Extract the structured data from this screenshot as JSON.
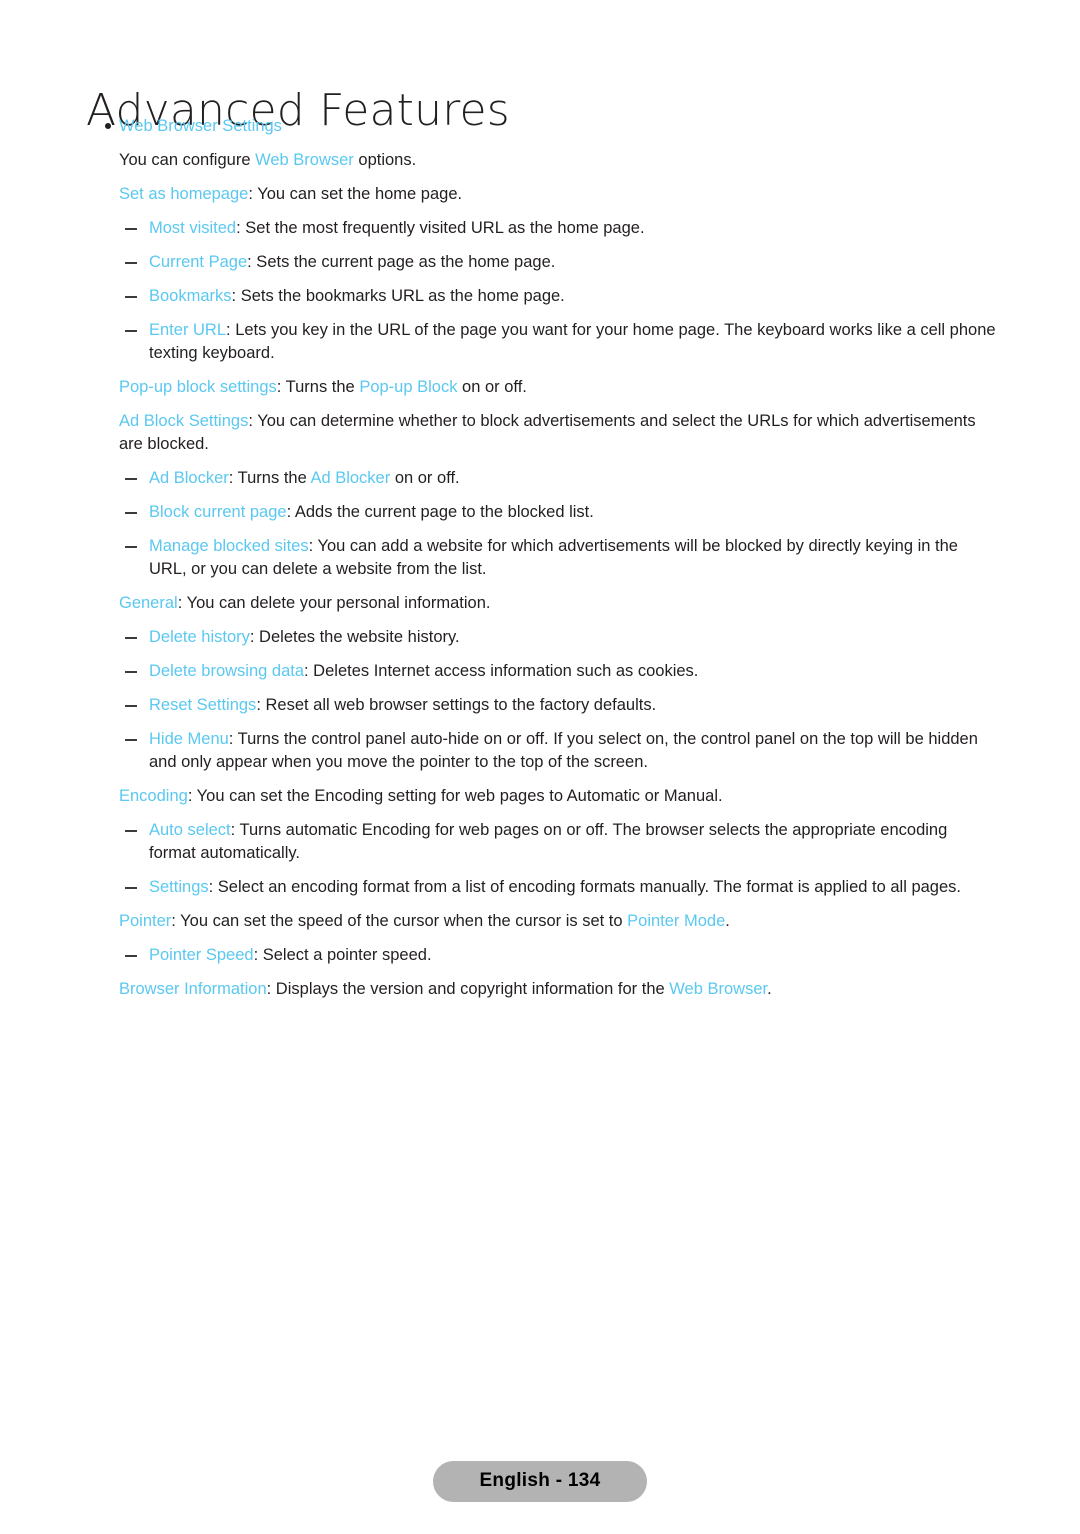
{
  "document": {
    "title": "Advanced Features",
    "accent_color": "#5ac8f0",
    "text_color": "#231f20"
  },
  "section": {
    "heading": "Web Browser Settings",
    "bullet_icon": "bullet-dot-icon",
    "dash_icon": "dash-marker-icon"
  },
  "blocks": [
    {
      "id": "intro",
      "type": "paragraph",
      "runs": [
        {
          "text": "You can configure ",
          "accent": false
        },
        {
          "text": "Web Browser",
          "accent": true
        },
        {
          "text": " options.",
          "accent": false
        }
      ]
    },
    {
      "id": "set-as-homepage",
      "type": "paragraph",
      "runs": [
        {
          "text": "Set as homepage",
          "accent": true
        },
        {
          "text": ": You can set the home page.",
          "accent": false
        }
      ]
    },
    {
      "id": "most-visited",
      "type": "dash",
      "runs": [
        {
          "text": "Most visited",
          "accent": true
        },
        {
          "text": ": Set the most frequently visited URL as the home page.",
          "accent": false
        }
      ]
    },
    {
      "id": "current-page",
      "type": "dash",
      "runs": [
        {
          "text": "Current Page",
          "accent": true
        },
        {
          "text": ": Sets the current page as the home page.",
          "accent": false
        }
      ]
    },
    {
      "id": "bookmarks",
      "type": "dash",
      "runs": [
        {
          "text": "Bookmarks",
          "accent": true
        },
        {
          "text": ": Sets the bookmarks URL as the home page.",
          "accent": false
        }
      ]
    },
    {
      "id": "enter-url",
      "type": "dash",
      "runs": [
        {
          "text": "Enter URL",
          "accent": true
        },
        {
          "text": ": Lets you key in the URL of the page you want for your home page. The keyboard works like a cell phone texting keyboard.",
          "accent": false
        }
      ]
    },
    {
      "id": "popup-block-settings",
      "type": "paragraph",
      "runs": [
        {
          "text": "Pop-up block settings",
          "accent": true
        },
        {
          "text": ": Turns the ",
          "accent": false
        },
        {
          "text": "Pop-up Block",
          "accent": true
        },
        {
          "text": " on or off.",
          "accent": false
        }
      ]
    },
    {
      "id": "ad-block-settings",
      "type": "paragraph",
      "runs": [
        {
          "text": "Ad Block Settings",
          "accent": true
        },
        {
          "text": ": You can determine whether to block advertisements and select the URLs for which advertisements are blocked.",
          "accent": false
        }
      ]
    },
    {
      "id": "ad-blocker",
      "type": "dash",
      "runs": [
        {
          "text": "Ad Blocker",
          "accent": true
        },
        {
          "text": ": Turns the ",
          "accent": false
        },
        {
          "text": "Ad Blocker",
          "accent": true
        },
        {
          "text": " on or off.",
          "accent": false
        }
      ]
    },
    {
      "id": "block-current-page",
      "type": "dash",
      "runs": [
        {
          "text": "Block current page",
          "accent": true
        },
        {
          "text": ": Adds the current page to the blocked list.",
          "accent": false
        }
      ]
    },
    {
      "id": "manage-blocked-sites",
      "type": "dash",
      "runs": [
        {
          "text": "Manage blocked sites",
          "accent": true
        },
        {
          "text": ": You can add a website for which advertisements will be blocked by directly keying in the URL, or you can delete a website from the list.",
          "accent": false
        }
      ]
    },
    {
      "id": "general",
      "type": "paragraph",
      "runs": [
        {
          "text": "General",
          "accent": true
        },
        {
          "text": ": You can delete your personal information.",
          "accent": false
        }
      ]
    },
    {
      "id": "delete-history",
      "type": "dash",
      "runs": [
        {
          "text": "Delete history",
          "accent": true
        },
        {
          "text": ": Deletes the website history.",
          "accent": false
        }
      ]
    },
    {
      "id": "delete-browsing-data",
      "type": "dash",
      "runs": [
        {
          "text": "Delete browsing data",
          "accent": true
        },
        {
          "text": ": Deletes Internet access information such as cookies.",
          "accent": false
        }
      ]
    },
    {
      "id": "reset-settings",
      "type": "dash",
      "runs": [
        {
          "text": "Reset Settings",
          "accent": true
        },
        {
          "text": ": Reset all web browser settings to the factory defaults.",
          "accent": false
        }
      ]
    },
    {
      "id": "hide-menu",
      "type": "dash",
      "runs": [
        {
          "text": "Hide Menu",
          "accent": true
        },
        {
          "text": ": Turns the control panel auto-hide on or off. If you select on, the control panel on the top will be hidden and only appear when you move the pointer to the top of the screen.",
          "accent": false
        }
      ]
    },
    {
      "id": "encoding",
      "type": "paragraph",
      "runs": [
        {
          "text": "Encoding",
          "accent": true
        },
        {
          "text": ": You can set the Encoding setting for web pages to Automatic or Manual.",
          "accent": false
        }
      ]
    },
    {
      "id": "auto-select",
      "type": "dash",
      "runs": [
        {
          "text": "Auto select",
          "accent": true
        },
        {
          "text": ": Turns automatic Encoding for web pages on or off. The browser selects the appropriate encoding format automatically.",
          "accent": false
        }
      ]
    },
    {
      "id": "settings",
      "type": "dash",
      "runs": [
        {
          "text": "Settings",
          "accent": true
        },
        {
          "text": ": Select an encoding format from a list of encoding formats manually. The format is applied to all pages.",
          "accent": false
        }
      ]
    },
    {
      "id": "pointer",
      "type": "paragraph",
      "runs": [
        {
          "text": "Pointer",
          "accent": true
        },
        {
          "text": ": You can set the speed of the cursor when the cursor is set to ",
          "accent": false
        },
        {
          "text": "Pointer Mode",
          "accent": true
        },
        {
          "text": ".",
          "accent": false
        }
      ]
    },
    {
      "id": "pointer-speed",
      "type": "dash",
      "runs": [
        {
          "text": "Pointer Speed",
          "accent": true
        },
        {
          "text": ": Select a pointer speed.",
          "accent": false
        }
      ]
    },
    {
      "id": "browser-information",
      "type": "paragraph",
      "runs": [
        {
          "text": "Browser Information",
          "accent": true
        },
        {
          "text": ": Displays the version and copyright information for the ",
          "accent": false
        },
        {
          "text": "Web Browser",
          "accent": true
        },
        {
          "text": ".",
          "accent": false
        }
      ]
    }
  ],
  "footer": {
    "page_label": "English - 134"
  }
}
